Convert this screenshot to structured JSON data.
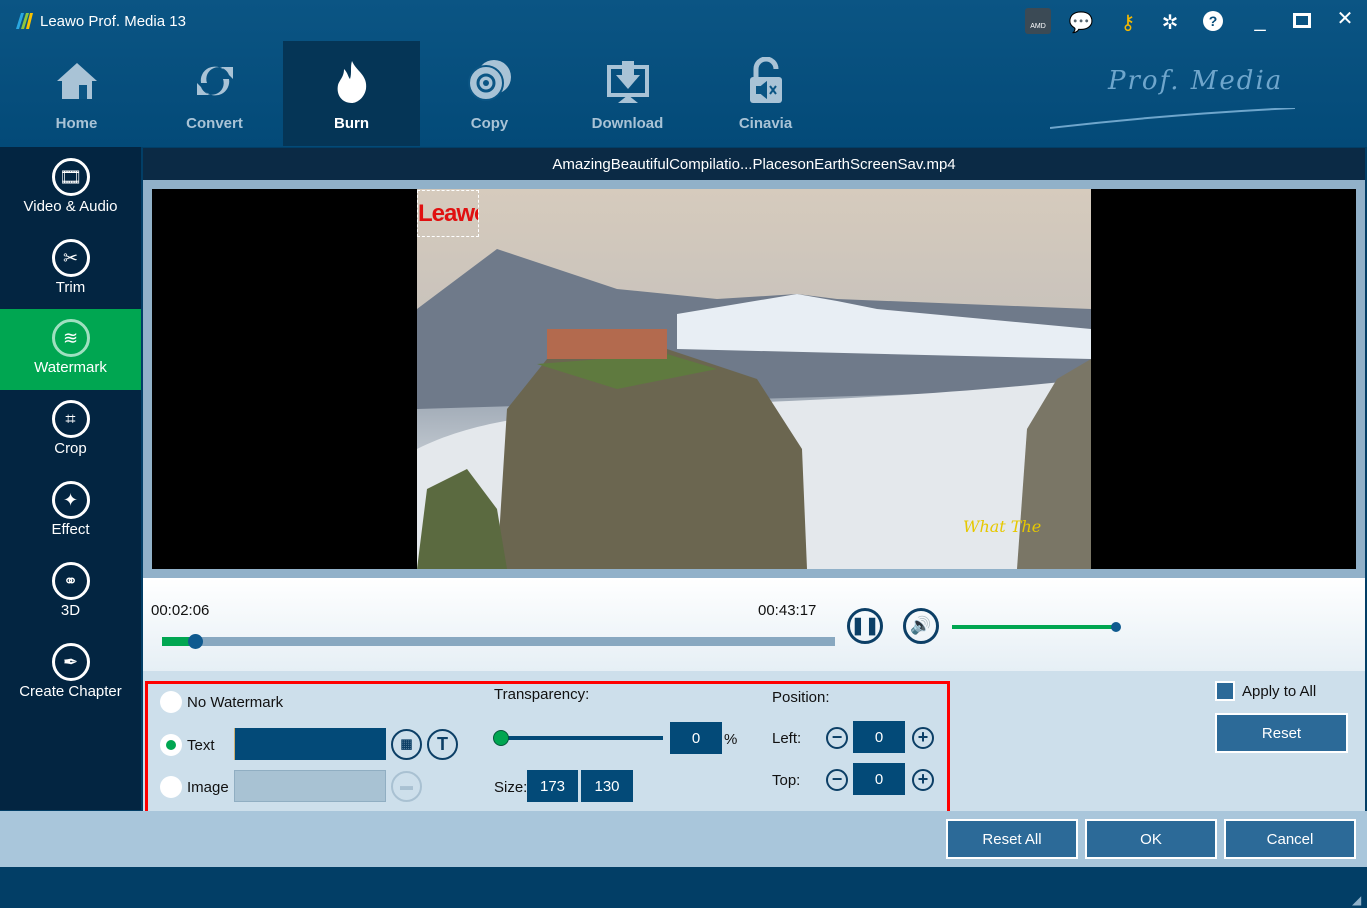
{
  "app": {
    "title": "Leawo Prof. Media 13",
    "brand": "Prof. Media"
  },
  "nav": [
    {
      "label": "Home",
      "icon": "home-icon"
    },
    {
      "label": "Convert",
      "icon": "convert-icon"
    },
    {
      "label": "Burn",
      "icon": "flame-icon",
      "active": true
    },
    {
      "label": "Copy",
      "icon": "disc-icon"
    },
    {
      "label": "Download",
      "icon": "download-icon"
    },
    {
      "label": "Cinavia",
      "icon": "unlock-mute-icon"
    }
  ],
  "sidebar": [
    {
      "label": "Video & Audio"
    },
    {
      "label": "Trim"
    },
    {
      "label": "Watermark",
      "active": true
    },
    {
      "label": "Crop"
    },
    {
      "label": "Effect"
    },
    {
      "label": "3D"
    },
    {
      "label": "Create Chapter"
    }
  ],
  "file_name": "AmazingBeautifulCompilatio...PlacesonEarthScreenSav.mp4",
  "preview": {
    "watermark_text": "Leawo",
    "corner_logo": "What The"
  },
  "player": {
    "current_time": "00:02:06",
    "total_time": "00:43:17",
    "progress_percent": 4.9,
    "volume_percent": 100
  },
  "watermark": {
    "no_watermark_label": "No Watermark",
    "text_label": "Text",
    "image_label": "Image",
    "selected": "Text",
    "text_value": "",
    "image_value": "",
    "transparency_label": "Transparency:",
    "transparency_value": "0",
    "transparency_unit": "%",
    "size_label": "Size:",
    "size_w": "173",
    "size_h": "130",
    "position_label": "Position:",
    "left_label": "Left:",
    "left_value": "0",
    "top_label": "Top:",
    "top_value": "0"
  },
  "apply_to_all_label": "Apply to All",
  "buttons": {
    "reset": "Reset",
    "reset_all": "Reset All",
    "ok": "OK",
    "cancel": "Cancel"
  },
  "colors": {
    "accent": "#00a651",
    "highlight_border": "#ff0000",
    "primary": "#034a78"
  }
}
